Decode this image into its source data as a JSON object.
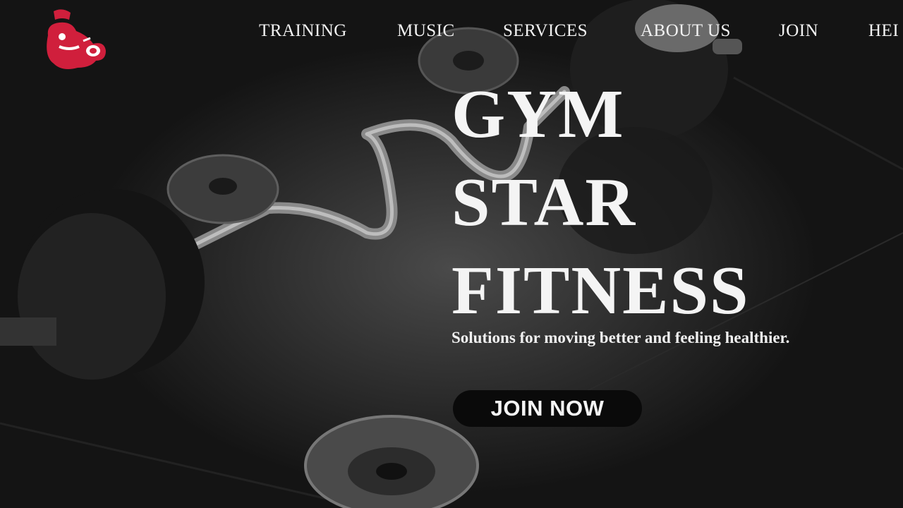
{
  "nav": {
    "items": [
      "TRAINING",
      "MUSIC",
      "SERVICES",
      "ABOUT US",
      "JOIN",
      "HEI"
    ]
  },
  "hero": {
    "headline_lines": [
      "GYM",
      "STAR",
      "FITNESS"
    ],
    "tagline": "Solutions for moving better and feeling healthier.",
    "cta_label": "JOIN NOW"
  },
  "logo": {
    "icon": "gym-mascot-logo",
    "color": "#d01f3c"
  },
  "colors": {
    "text": "#f2f2f2",
    "button_bg": "#0a0a0a",
    "accent": "#d01f3c"
  }
}
